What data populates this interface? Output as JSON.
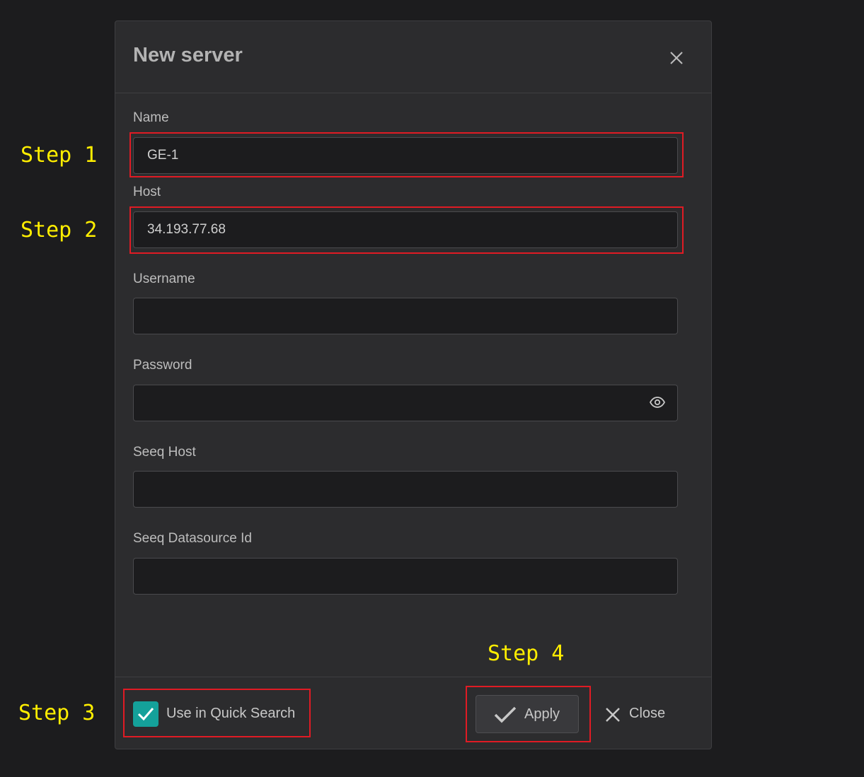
{
  "dialog": {
    "title": "New server",
    "close_icon": "close-icon"
  },
  "fields": {
    "name": {
      "label": "Name",
      "value": "GE-1"
    },
    "host": {
      "label": "Host",
      "value": "34.193.77.68"
    },
    "username": {
      "label": "Username",
      "value": ""
    },
    "password": {
      "label": "Password",
      "value": "",
      "icon": "eye-icon"
    },
    "seeq_host": {
      "label": "Seeq Host",
      "value": ""
    },
    "seeq_datasource_id": {
      "label": "Seeq Datasource Id",
      "value": ""
    }
  },
  "footer": {
    "checkbox_label": "Use in Quick Search",
    "checkbox_checked": true,
    "apply_label": "Apply",
    "close_label": "Close"
  },
  "annotations": {
    "step1": "Step 1",
    "step2": "Step 2",
    "step3": "Step 3",
    "step4": "Step 4"
  },
  "colors": {
    "background": "#1c1c1e",
    "dialog": "#2c2c2e",
    "accent": "#14a19a",
    "annotation_box": "#e01b24",
    "annotation_text": "#ffee00"
  }
}
